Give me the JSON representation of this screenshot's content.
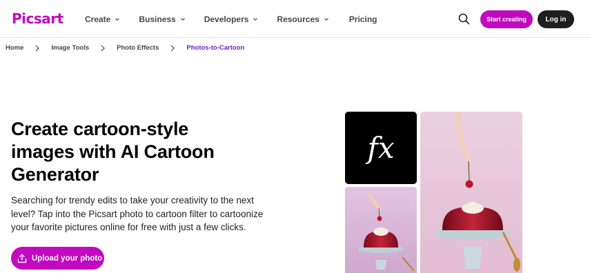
{
  "brand": {
    "logo_text": "Picsart",
    "accent_color": "#c209c1"
  },
  "nav": {
    "items": [
      {
        "label": "Create",
        "has_dropdown": true
      },
      {
        "label": "Business",
        "has_dropdown": true
      },
      {
        "label": "Developers",
        "has_dropdown": true
      },
      {
        "label": "Resources",
        "has_dropdown": true
      },
      {
        "label": "Pricing",
        "has_dropdown": false
      }
    ],
    "search_icon": "search-icon",
    "start_creating_label": "Start creating",
    "login_label": "Log in"
  },
  "breadcrumb": {
    "items": [
      "Home",
      "Image Tools",
      "Photo Effects",
      "Photos-to-Cartoon"
    ]
  },
  "hero": {
    "title": "Create cartoon-style images with AI Cartoon Generator",
    "description": "Searching for trendy edits to take your creativity to the next level? Tap into the Picsart photo to cartoon filter to cartoonize your favorite pictures online for free with just a few clicks.",
    "upload_label": "Upload your photo",
    "upload_icon": "upload-icon"
  },
  "gallery": {
    "fx_label": "fx"
  }
}
